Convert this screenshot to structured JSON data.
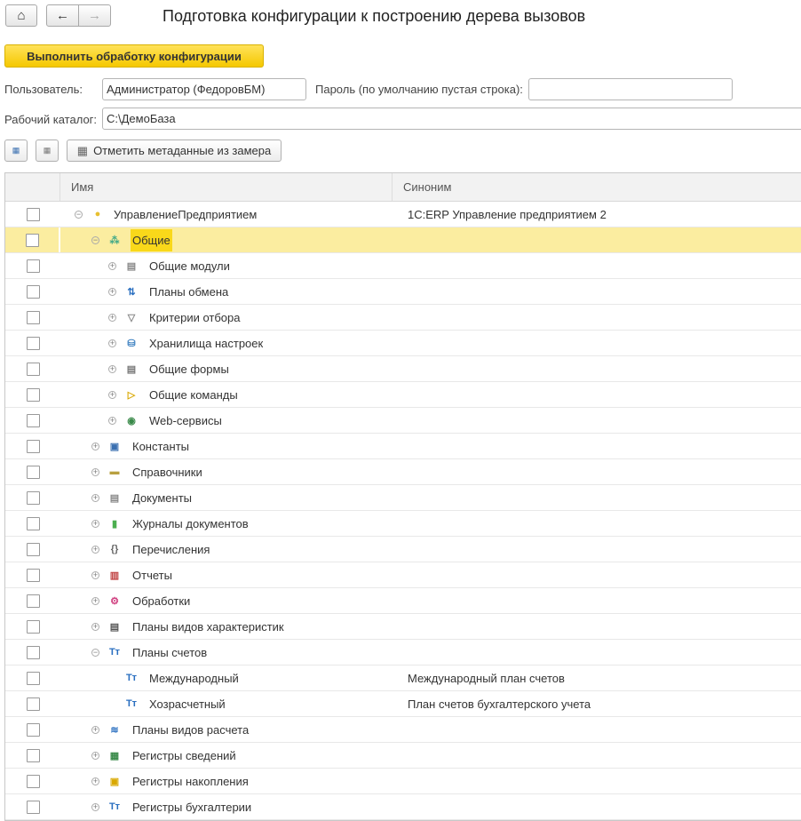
{
  "nav": {
    "home_icon": "⌂",
    "back_icon": "←",
    "forward_icon": "→"
  },
  "title": "Подготовка конфигурации к построению дерева вызовов",
  "run_button": "Выполнить обработку конфигурации",
  "user_label": "Пользователь:",
  "user_value": "Администратор (ФедоровБМ)",
  "password_label": "Пароль (по умолчанию пустая строка):",
  "password_value": "",
  "dir_label": "Рабочий каталог:",
  "dir_value": "C:\\ДемоБаза",
  "mark_button": "Отметить метаданные из замера",
  "columns": {
    "name": "Имя",
    "synonym": "Синоним"
  },
  "rows": [
    {
      "level": 0,
      "exp": "-",
      "icon": "ball",
      "name": "УправлениеПредприятием",
      "synonym": "1С:ERP Управление предприятием 2"
    },
    {
      "level": 1,
      "exp": "-",
      "icon": "common",
      "name": "Общие",
      "synonym": "",
      "selected": true
    },
    {
      "level": 2,
      "exp": "+",
      "icon": "module",
      "name": "Общие модули",
      "synonym": ""
    },
    {
      "level": 2,
      "exp": "+",
      "icon": "exchange",
      "name": "Планы обмена",
      "synonym": ""
    },
    {
      "level": 2,
      "exp": "+",
      "icon": "filter",
      "name": "Критерии отбора",
      "synonym": ""
    },
    {
      "level": 2,
      "exp": "+",
      "icon": "storage",
      "name": "Хранилища настроек",
      "synonym": ""
    },
    {
      "level": 2,
      "exp": "+",
      "icon": "form",
      "name": "Общие формы",
      "synonym": ""
    },
    {
      "level": 2,
      "exp": "+",
      "icon": "command",
      "name": "Общие команды",
      "synonym": ""
    },
    {
      "level": 2,
      "exp": "+",
      "icon": "globe",
      "name": "Web-сервисы",
      "synonym": ""
    },
    {
      "level": 1,
      "exp": "+",
      "icon": "constants",
      "name": "Константы",
      "synonym": ""
    },
    {
      "level": 1,
      "exp": "+",
      "icon": "catalog",
      "name": "Справочники",
      "synonym": ""
    },
    {
      "level": 1,
      "exp": "+",
      "icon": "document",
      "name": "Документы",
      "synonym": ""
    },
    {
      "level": 1,
      "exp": "+",
      "icon": "journal",
      "name": "Журналы документов",
      "synonym": ""
    },
    {
      "level": 1,
      "exp": "+",
      "icon": "enum",
      "name": "Перечисления",
      "synonym": ""
    },
    {
      "level": 1,
      "exp": "+",
      "icon": "report",
      "name": "Отчеты",
      "synonym": ""
    },
    {
      "level": 1,
      "exp": "+",
      "icon": "processing",
      "name": "Обработки",
      "synonym": ""
    },
    {
      "level": 1,
      "exp": "+",
      "icon": "chartchar",
      "name": "Планы видов характеристик",
      "synonym": ""
    },
    {
      "level": 1,
      "exp": "-",
      "icon": "accounts",
      "name": "Планы счетов",
      "synonym": ""
    },
    {
      "level": 2,
      "exp": "",
      "icon": "accounts",
      "name": "Международный",
      "synonym": "Международный план счетов"
    },
    {
      "level": 2,
      "exp": "",
      "icon": "accounts",
      "name": "Хозрасчетный",
      "synonym": "План счетов бухгалтерского учета"
    },
    {
      "level": 1,
      "exp": "+",
      "icon": "calc",
      "name": "Планы видов расчета",
      "synonym": ""
    },
    {
      "level": 1,
      "exp": "+",
      "icon": "inforeg",
      "name": "Регистры сведений",
      "synonym": ""
    },
    {
      "level": 1,
      "exp": "+",
      "icon": "accumreg",
      "name": "Регистры накопления",
      "synonym": ""
    },
    {
      "level": 1,
      "exp": "+",
      "icon": "accounts",
      "name": "Регистры бухгалтерии",
      "synonym": ""
    }
  ]
}
